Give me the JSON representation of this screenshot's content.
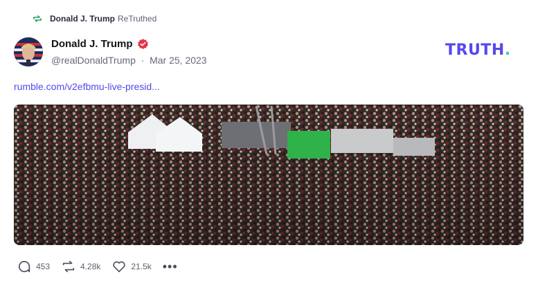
{
  "retruth": {
    "user": "Donald J. Trump",
    "label": "ReTruthed"
  },
  "author": {
    "name": "Donald J. Trump",
    "handle": "@realDonaldTrump",
    "date": "Mar 25, 2023"
  },
  "brand": {
    "logo_text": "TRUTH",
    "logo_dot": "."
  },
  "post": {
    "link_text": "rumble.com/v2efbmu-live-presid..."
  },
  "actions": {
    "replies": "453",
    "retruths": "4.28k",
    "likes": "21.5k",
    "more": "•••"
  },
  "colors": {
    "brand": "#5448ee",
    "accent": "#40c9b5",
    "retruth_icon": "#23a065",
    "verified": "#e0354d"
  }
}
